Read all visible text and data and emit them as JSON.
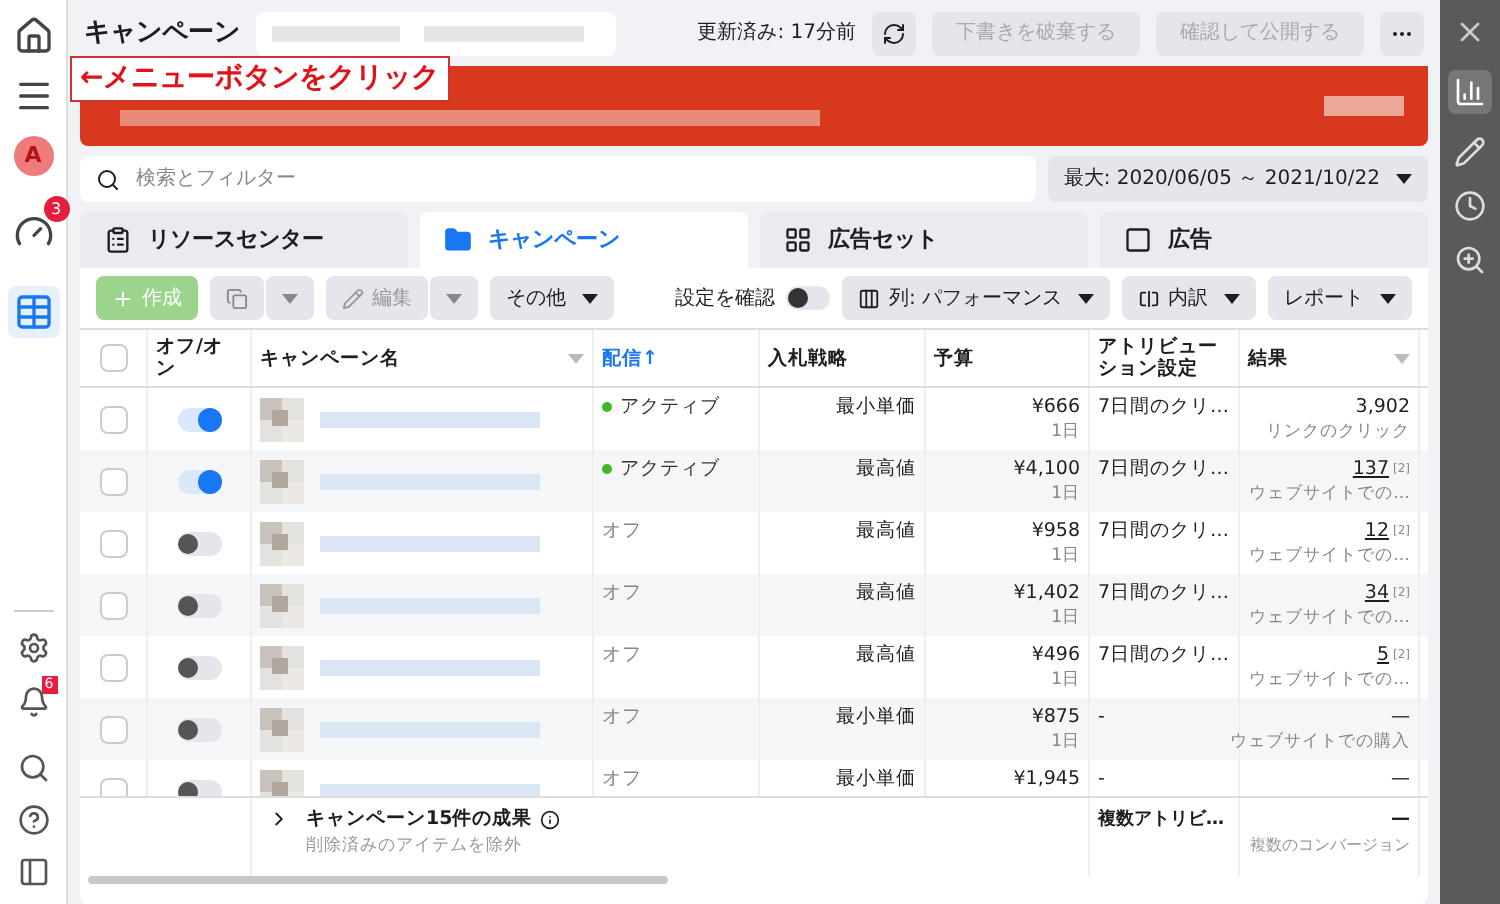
{
  "left_rail": {
    "avatar": "A",
    "gauge_badge": "3",
    "bell_badge": "6"
  },
  "header": {
    "title": "キャンペーン",
    "updated": "更新済み: 17分前",
    "buttons": [
      "下書きを破棄する",
      "確認して公開する"
    ]
  },
  "annotation": "←メニューボタンをクリック",
  "search": {
    "placeholder": "検索とフィルター",
    "date_range": "最大: 2020/06/05 ～ 2021/10/22"
  },
  "tabs": [
    {
      "label": "リソースセンター",
      "kind": "resources",
      "selected": false
    },
    {
      "label": "キャンペーン",
      "kind": "campaigns",
      "selected": true
    },
    {
      "label": "広告セット",
      "kind": "adsets",
      "selected": false
    },
    {
      "label": "広告",
      "kind": "ads",
      "selected": false
    }
  ],
  "toolbar": {
    "create": "作成",
    "edit": "編集",
    "more": "その他",
    "review_label": "設定を確認",
    "review_on": false,
    "columns": "列: パフォーマンス",
    "breakdown": "内訳",
    "reports": "レポート"
  },
  "table": {
    "all_checked": false,
    "columns": [
      {
        "label": "オフ/オン",
        "sorted": false
      },
      {
        "label": "キャンペーン名",
        "sorted": false
      },
      {
        "label": "配信↑",
        "sorted": true
      },
      {
        "label": "入札戦略",
        "sorted": false
      },
      {
        "label": "予算",
        "sorted": false
      },
      {
        "label": "アトリビューション設定",
        "sorted": false
      },
      {
        "label": "結果",
        "sorted": false
      }
    ],
    "rows": [
      {
        "checked": false,
        "on": true,
        "status": "アクティブ",
        "active": true,
        "bid": "最小単価",
        "budget": "¥666",
        "period": "1日",
        "attribution": "7日間のクリ…",
        "result": "3,902",
        "link": false,
        "result_label": "リンクのクリック"
      },
      {
        "checked": false,
        "on": true,
        "status": "アクティブ",
        "active": true,
        "bid": "最高値",
        "budget": "¥4,100",
        "period": "1日",
        "attribution": "7日間のクリ…",
        "result": "137",
        "link": true,
        "note": "[2]",
        "result_label": "ウェブサイトでの…"
      },
      {
        "checked": false,
        "on": false,
        "status": "オフ",
        "active": false,
        "bid": "最高値",
        "budget": "¥958",
        "period": "1日",
        "attribution": "7日間のクリ…",
        "result": "12",
        "link": true,
        "note": "[2]",
        "result_label": "ウェブサイトでの…"
      },
      {
        "checked": false,
        "on": false,
        "status": "オフ",
        "active": false,
        "bid": "最高値",
        "budget": "¥1,402",
        "period": "1日",
        "attribution": "7日間のクリ…",
        "result": "34",
        "link": true,
        "note": "[2]",
        "result_label": "ウェブサイトでの…"
      },
      {
        "checked": false,
        "on": false,
        "status": "オフ",
        "active": false,
        "bid": "最高値",
        "budget": "¥496",
        "period": "1日",
        "attribution": "7日間のクリ…",
        "result": "5",
        "link": true,
        "note": "[2]",
        "result_label": "ウェブサイトでの…"
      },
      {
        "checked": false,
        "on": false,
        "status": "オフ",
        "active": false,
        "bid": "最小単価",
        "budget": "¥875",
        "period": "1日",
        "attribution": "-",
        "result": "—",
        "link": false,
        "result_label": "ウェブサイトでの購入"
      },
      {
        "checked": false,
        "on": false,
        "status": "オフ",
        "active": false,
        "bid": "最小単価",
        "budget": "¥1,945",
        "attribution": "-",
        "result": "—",
        "link": false
      }
    ],
    "summary": {
      "title": "キャンペーン15件の成果",
      "subtitle": "削除済みのアイテムを除外",
      "attribution": "複数アトリビ…",
      "result": "—",
      "result_label": "複数のコンバージョン"
    }
  }
}
